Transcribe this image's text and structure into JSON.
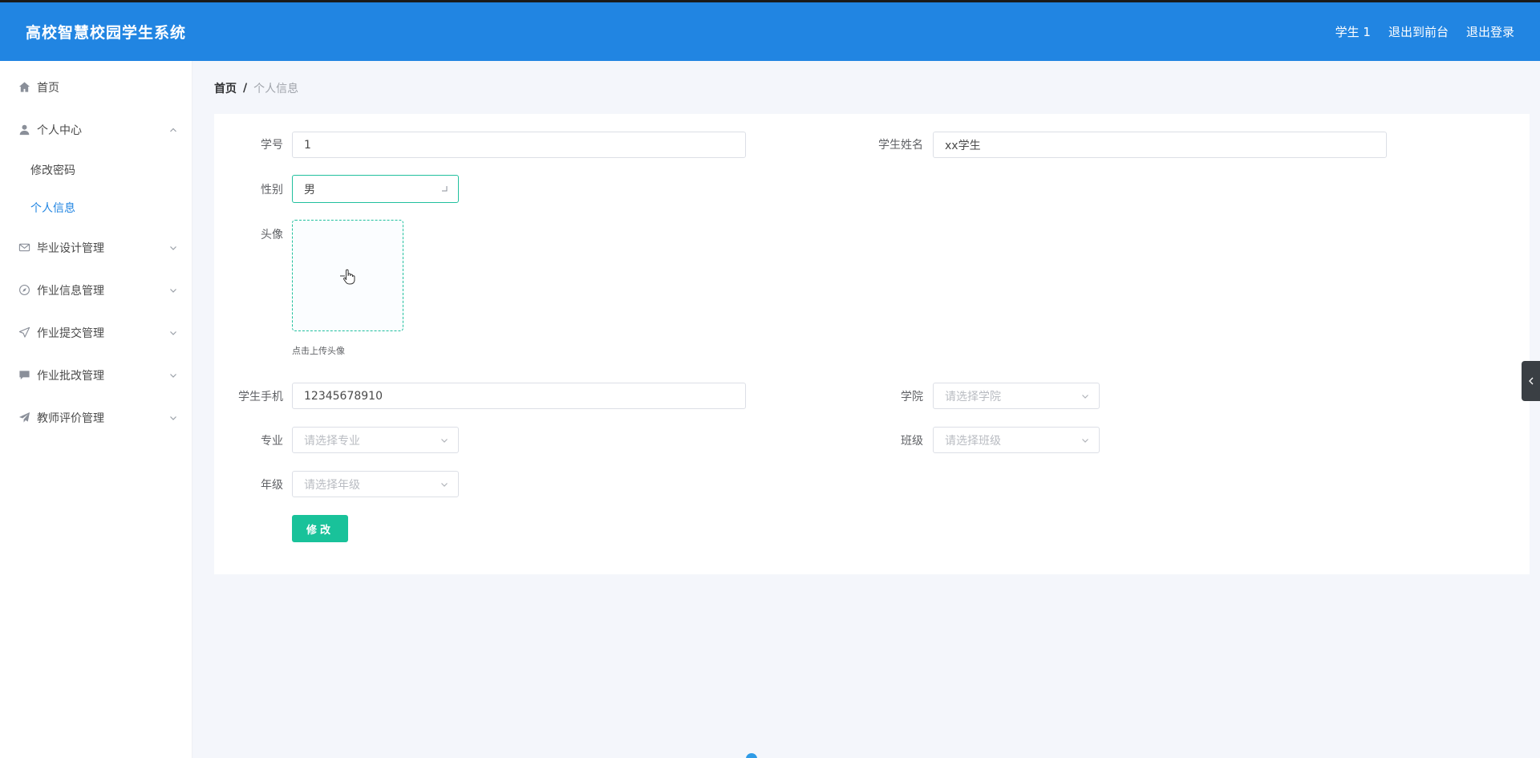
{
  "header": {
    "title": "高校智慧校园学生系统",
    "user": "学生 1",
    "to_front": "退出到前台",
    "logout": "退出登录"
  },
  "sidebar": {
    "items": [
      {
        "label": "首页",
        "icon": "home-icon"
      },
      {
        "label": "个人中心",
        "icon": "user-icon",
        "expanded": true,
        "children": [
          {
            "label": "修改密码"
          },
          {
            "label": "个人信息",
            "active": true
          }
        ]
      },
      {
        "label": "毕业设计管理",
        "icon": "mail-icon"
      },
      {
        "label": "作业信息管理",
        "icon": "compass-icon"
      },
      {
        "label": "作业提交管理",
        "icon": "send-icon"
      },
      {
        "label": "作业批改管理",
        "icon": "chat-icon"
      },
      {
        "label": "教师评价管理",
        "icon": "paper-plane-icon"
      }
    ]
  },
  "breadcrumb": {
    "home": "首页",
    "separator": "/",
    "current": "个人信息"
  },
  "form": {
    "student_no": {
      "label": "学号",
      "value": "1"
    },
    "student_name": {
      "label": "学生姓名",
      "value": "xx学生"
    },
    "gender": {
      "label": "性别",
      "value": "男"
    },
    "avatar": {
      "label": "头像",
      "tip": "点击上传头像"
    },
    "phone": {
      "label": "学生手机",
      "value": "12345678910"
    },
    "college": {
      "label": "学院",
      "placeholder": "请选择学院"
    },
    "major": {
      "label": "专业",
      "placeholder": "请选择专业"
    },
    "class": {
      "label": "班级",
      "placeholder": "请选择班级"
    },
    "grade": {
      "label": "年级",
      "placeholder": "请选择年级"
    },
    "submit": "修改"
  },
  "colors": {
    "header": "#2185e2",
    "accent": "#19c29a",
    "active_menu": "#2185e2"
  }
}
